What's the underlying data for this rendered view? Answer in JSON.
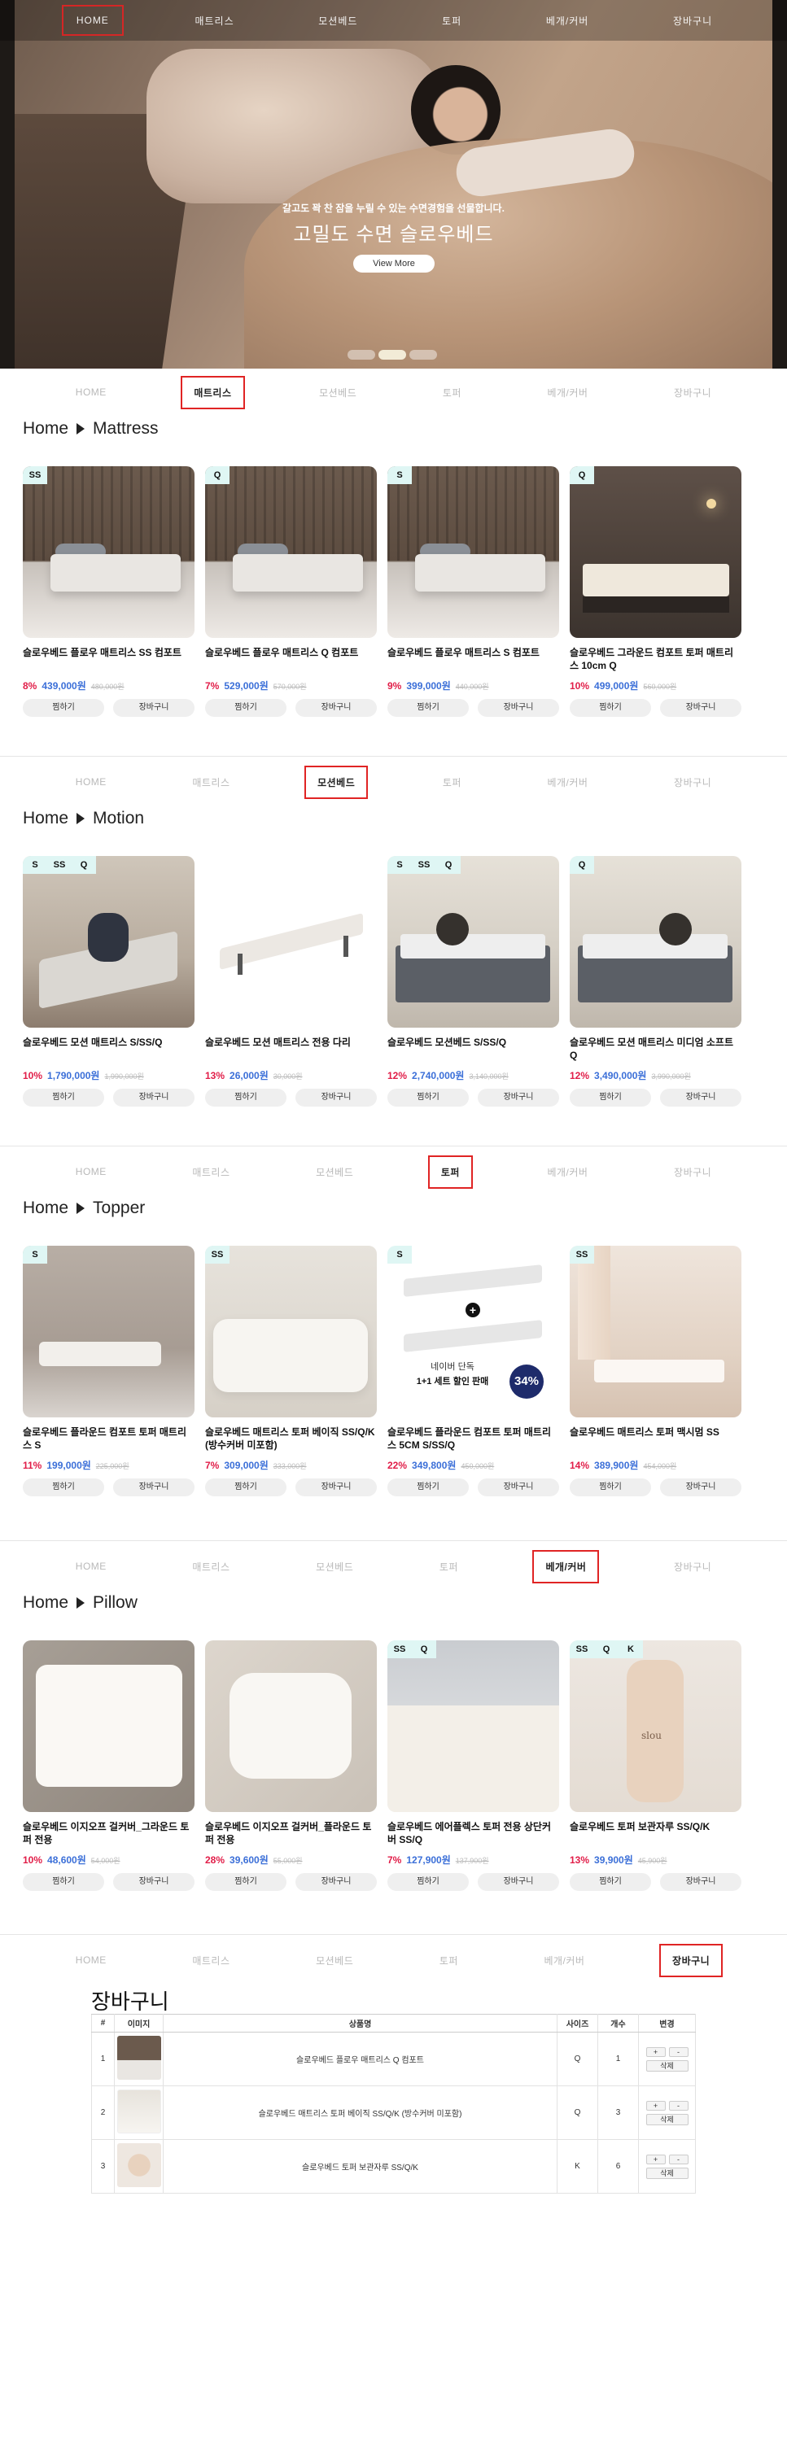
{
  "nav": [
    "HOME",
    "매트리스",
    "모션베드",
    "토퍼",
    "베개/커버",
    "장바구니"
  ],
  "hero": {
    "subtitle": "갈고도 꽉 찬 잠을 누릴 수 있는 수면경험을 선물합니다.",
    "title": "고밀도 수면 슬로우베드",
    "button": "View More"
  },
  "labels": {
    "wish": "찜하기",
    "cart": "장바구니",
    "home": "Home"
  },
  "sections": {
    "mattress": {
      "crumb": "Mattress",
      "products": [
        {
          "badges": [
            "SS"
          ],
          "name": "슬로우베드 플로우 매트리스 SS 컴포트",
          "pct": "8%",
          "price": "439,000원",
          "orig": "480,000원"
        },
        {
          "badges": [
            "Q"
          ],
          "name": "슬로우베드 플로우 매트리스 Q 컴포트",
          "pct": "7%",
          "price": "529,000원",
          "orig": "570,000원"
        },
        {
          "badges": [
            "S"
          ],
          "name": "슬로우베드 플로우 매트리스 S 컴포트",
          "pct": "9%",
          "price": "399,000원",
          "orig": "440,000원"
        },
        {
          "badges": [
            "Q"
          ],
          "name": "슬로우베드 그라운드 컴포트 토퍼 매트리스 10cm Q",
          "pct": "10%",
          "price": "499,000원",
          "orig": "560,000원"
        }
      ]
    },
    "motion": {
      "crumb": "Motion",
      "products": [
        {
          "badges": [
            "S",
            "SS",
            "Q"
          ],
          "name": "슬로우베드 모션 매트리스 S/SS/Q",
          "pct": "10%",
          "price": "1,790,000원",
          "orig": "1,990,000원"
        },
        {
          "badges": [],
          "name": "슬로우베드 모션 매트리스 전용 다리",
          "pct": "13%",
          "price": "26,000원",
          "orig": "30,000원"
        },
        {
          "badges": [
            "S",
            "SS",
            "Q"
          ],
          "name": "슬로우베드 모션베드 S/SS/Q",
          "pct": "12%",
          "price": "2,740,000원",
          "orig": "3,140,000원"
        },
        {
          "badges": [
            "Q"
          ],
          "name": "슬로우베드 모션 매트리스 미디엄 소프트 Q",
          "pct": "12%",
          "price": "3,490,000원",
          "orig": "3,990,000원"
        }
      ]
    },
    "topper": {
      "crumb": "Topper",
      "products": [
        {
          "badges": [
            "S"
          ],
          "name": "슬로우베드 플라운드 컴포트 토퍼 매트리스 S",
          "pct": "11%",
          "price": "199,000원",
          "orig": "225,000원"
        },
        {
          "badges": [
            "SS"
          ],
          "name": "슬로우베드 매트리스 토퍼 베이직 SS/Q/K (방수커버 미포함)",
          "pct": "7%",
          "price": "309,000원",
          "orig": "333,000원"
        },
        {
          "badges": [
            "S"
          ],
          "name": "슬로우베드 플라운드 컴포트 토퍼 매트리스 5CM S/SS/Q",
          "pct": "22%",
          "price": "349,800원",
          "orig": "450,000원"
        },
        {
          "badges": [
            "SS"
          ],
          "name": "슬로우베드 매트리스 토퍼 맥시멈 SS",
          "pct": "14%",
          "price": "389,900원",
          "orig": "454,000원"
        }
      ],
      "promo": {
        "line1": "네이버 단독",
        "line2": "1+1 세트 할인 판매",
        "pct": "34%"
      }
    },
    "pillow": {
      "crumb": "Pillow",
      "products": [
        {
          "badges": [],
          "name": "슬로우베드 이지오프 걸커버_그라운드 토퍼 전용",
          "pct": "10%",
          "price": "48,600원",
          "orig": "54,000원"
        },
        {
          "badges": [],
          "name": "슬로우베드 이지오프 걸커버_플라운드 토퍼 전용",
          "pct": "28%",
          "price": "39,600원",
          "orig": "55,000원"
        },
        {
          "badges": [
            "SS",
            "Q"
          ],
          "name": "슬로우베드 에어플렉스 토퍼 전용 상단커버 SS/Q",
          "pct": "7%",
          "price": "127,900원",
          "orig": "137,900원"
        },
        {
          "badges": [
            "SS",
            "Q",
            "K"
          ],
          "name": "슬로우베드 토퍼 보관자루 SS/Q/K",
          "pct": "13%",
          "price": "39,900원",
          "orig": "45,900원"
        }
      ],
      "bag_label": "slou"
    }
  },
  "cart": {
    "title": "장바구니",
    "headers": [
      "#",
      "이미지",
      "상품명",
      "사이즈",
      "개수",
      "변경"
    ],
    "rows": [
      {
        "no": "1",
        "name": "슬로우베드 플로우 매트리스 Q 컴포트",
        "size": "Q",
        "qty": "1"
      },
      {
        "no": "2",
        "name": "슬로우베드 매트리스 토퍼 베이직 SS/Q/K (방수커버 미포함)",
        "size": "Q",
        "qty": "3"
      },
      {
        "no": "3",
        "name": "슬로우베드 토퍼 보관자루 SS/Q/K",
        "size": "K",
        "qty": "6"
      }
    ],
    "plus": "+",
    "minus": "-",
    "delete": "삭제"
  }
}
